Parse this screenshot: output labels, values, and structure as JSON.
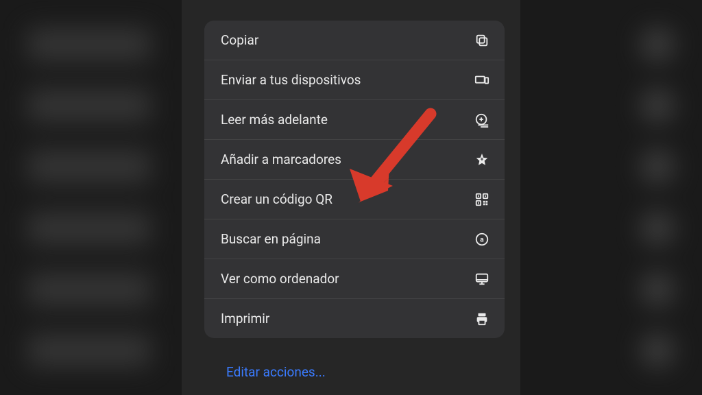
{
  "menu": {
    "items": [
      {
        "label": "Copiar",
        "icon": "copy-icon"
      },
      {
        "label": "Enviar a tus dispositivos",
        "icon": "devices-icon"
      },
      {
        "label": "Leer más adelante",
        "icon": "read-later-icon"
      },
      {
        "label": "Añadir a marcadores",
        "icon": "star-add-icon"
      },
      {
        "label": "Crear un código QR",
        "icon": "qr-icon"
      },
      {
        "label": "Buscar en página",
        "icon": "search-page-icon"
      },
      {
        "label": "Ver como ordenador",
        "icon": "desktop-icon"
      },
      {
        "label": "Imprimir",
        "icon": "print-icon"
      }
    ]
  },
  "footer": {
    "edit_label": "Editar acciones..."
  },
  "annotation": {
    "arrow_color": "#d83a2b",
    "points_to": "Crear un código QR"
  }
}
